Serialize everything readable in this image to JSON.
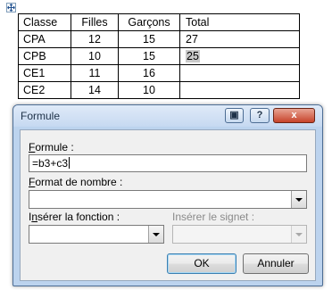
{
  "table": {
    "headers": [
      "Classe",
      "Filles",
      "Garçons",
      "Total"
    ],
    "rows": [
      [
        "CPA",
        "12",
        "15",
        "27"
      ],
      [
        "CPB",
        "10",
        "15",
        "25"
      ],
      [
        "CE1",
        "11",
        "16",
        ""
      ],
      [
        "CE2",
        "14",
        "10",
        ""
      ]
    ]
  },
  "dialog": {
    "title": "Formule",
    "title_buttons": {
      "restore": "▣",
      "help": "?",
      "close": "x"
    },
    "formula_label_key": "F",
    "formula_label_rest": "ormule :",
    "formula_value": "=b3+c3",
    "number_format_label_key": "F",
    "number_format_label_rest": "ormat de nombre :",
    "number_format_value": "",
    "insert_function_label_pre": "I",
    "insert_function_label_key": "n",
    "insert_function_label_rest": "sérer la fonction :",
    "insert_function_value": "",
    "insert_bookmark_label": "Insérer le signet :",
    "insert_bookmark_value": "",
    "ok_label": "OK",
    "cancel_label": "Annuler"
  },
  "colors": {
    "dialog_frame": "#bcd3ee",
    "close_button": "#c7432a",
    "selection": "#c9c9c9"
  }
}
